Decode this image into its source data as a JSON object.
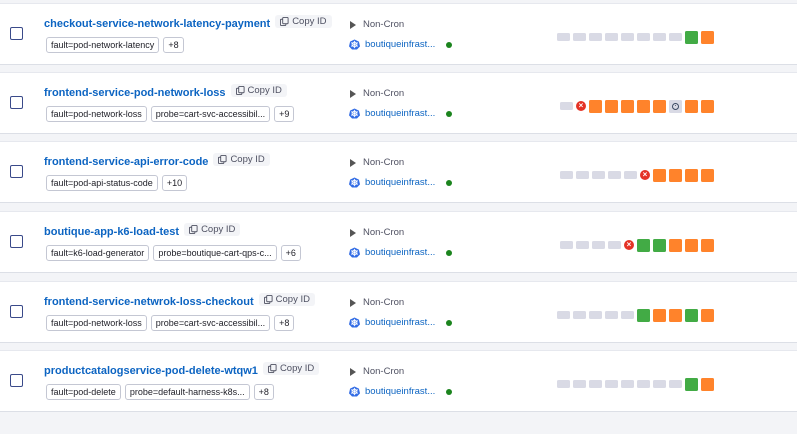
{
  "copy_id_label": "Copy ID",
  "colors": {
    "link": "#0c64c2",
    "success": "#42ab45",
    "failed": "#ff832b",
    "empty": "#d9dae5",
    "error": "#e43326",
    "active_dot": "#1b841d"
  },
  "experiments": [
    {
      "name": "checkout-service-network-latency-payment",
      "tags": [
        "fault=pod-network-latency"
      ],
      "more": "+8",
      "type": "Non-Cron",
      "infra": "boutiqueinfrast...",
      "runs": [
        "empty",
        "empty",
        "empty",
        "empty",
        "empty",
        "empty",
        "empty",
        "empty",
        "success",
        "failed"
      ]
    },
    {
      "name": "frontend-service-pod-network-loss",
      "tags": [
        "fault=pod-network-loss",
        "probe=cart-svc-accessibil..."
      ],
      "more": "+9",
      "type": "Non-Cron",
      "infra": "boutiqueinfrast...",
      "runs": [
        "empty",
        "error",
        "failed",
        "failed",
        "failed",
        "failed",
        "failed",
        "running",
        "failed",
        "failed"
      ]
    },
    {
      "name": "frontend-service-api-error-code",
      "tags": [
        "fault=pod-api-status-code"
      ],
      "more": "+10",
      "type": "Non-Cron",
      "infra": "boutiqueinfrast...",
      "runs": [
        "empty",
        "empty",
        "empty",
        "empty",
        "empty",
        "error",
        "failed",
        "failed",
        "failed",
        "failed"
      ]
    },
    {
      "name": "boutique-app-k6-load-test",
      "tags": [
        "fault=k6-load-generator",
        "probe=boutique-cart-qps-c..."
      ],
      "more": "+6",
      "type": "Non-Cron",
      "infra": "boutiqueinfrast...",
      "runs": [
        "empty",
        "empty",
        "empty",
        "empty",
        "error",
        "success",
        "success",
        "failed",
        "failed",
        "failed"
      ]
    },
    {
      "name": "frontend-service-netwrok-loss-checkout",
      "tags": [
        "fault=pod-network-loss",
        "probe=cart-svc-accessibil..."
      ],
      "more": "+8",
      "type": "Non-Cron",
      "infra": "boutiqueinfrast...",
      "runs": [
        "empty",
        "empty",
        "empty",
        "empty",
        "empty",
        "success",
        "failed",
        "failed",
        "success",
        "failed"
      ]
    },
    {
      "name": "productcatalogservice-pod-delete-wtqw1",
      "tags": [
        "fault=pod-delete",
        "probe=default-harness-k8s..."
      ],
      "more": "+8",
      "type": "Non-Cron",
      "infra": "boutiqueinfrast...",
      "runs": [
        "empty",
        "empty",
        "empty",
        "empty",
        "empty",
        "empty",
        "empty",
        "empty",
        "success",
        "failed"
      ]
    }
  ]
}
